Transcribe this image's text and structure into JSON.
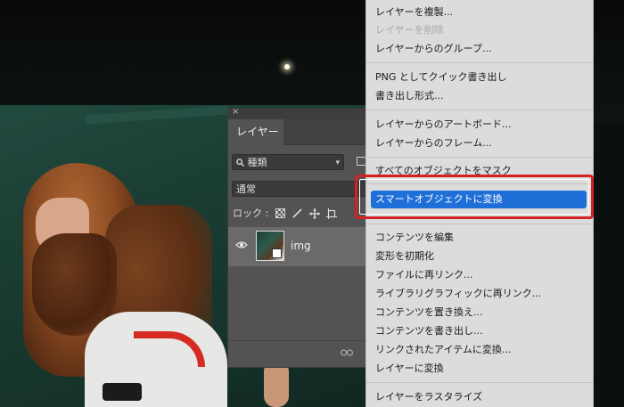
{
  "layers_panel": {
    "close_glyph": "×",
    "tab_label": "レイヤー",
    "filter_label": "種類",
    "blend_mode": "通常",
    "lock_label": "ロック :",
    "layer_name": "img"
  },
  "context_menu": {
    "items": [
      {
        "label": "レイヤーを複製...",
        "enabled": true
      },
      {
        "label": "レイヤーを削除",
        "enabled": false
      },
      {
        "label": "レイヤーからのグループ...",
        "enabled": true
      },
      {
        "label": "PNG としてクイック書き出し",
        "enabled": true
      },
      {
        "label": "書き出し形式...",
        "enabled": true
      },
      {
        "label": "レイヤーからのアートボード...",
        "enabled": true
      },
      {
        "label": "レイヤーからのフレーム...",
        "enabled": true
      },
      {
        "label": "すべてのオブジェクトをマスク",
        "enabled": true
      },
      {
        "label": "スマートオブジェクトに変換",
        "enabled": true,
        "selected": true
      },
      {
        "label": "コンテンツを編集",
        "enabled": true
      },
      {
        "label": "変形を初期化",
        "enabled": true
      },
      {
        "label": "ファイルに再リンク...",
        "enabled": true
      },
      {
        "label": "ライブラリグラフィックに再リンク...",
        "enabled": true
      },
      {
        "label": "コンテンツを置き換え...",
        "enabled": true
      },
      {
        "label": "コンテンツを書き出し...",
        "enabled": true
      },
      {
        "label": "リンクされたアイテムに変換...",
        "enabled": true
      },
      {
        "label": "レイヤーに変換",
        "enabled": true
      },
      {
        "label": "レイヤーをラスタライズ",
        "enabled": true
      }
    ]
  },
  "colors": {
    "menu_selected": "#1e6fd8",
    "highlight_border": "#d42222",
    "panel_bg": "#535353"
  }
}
